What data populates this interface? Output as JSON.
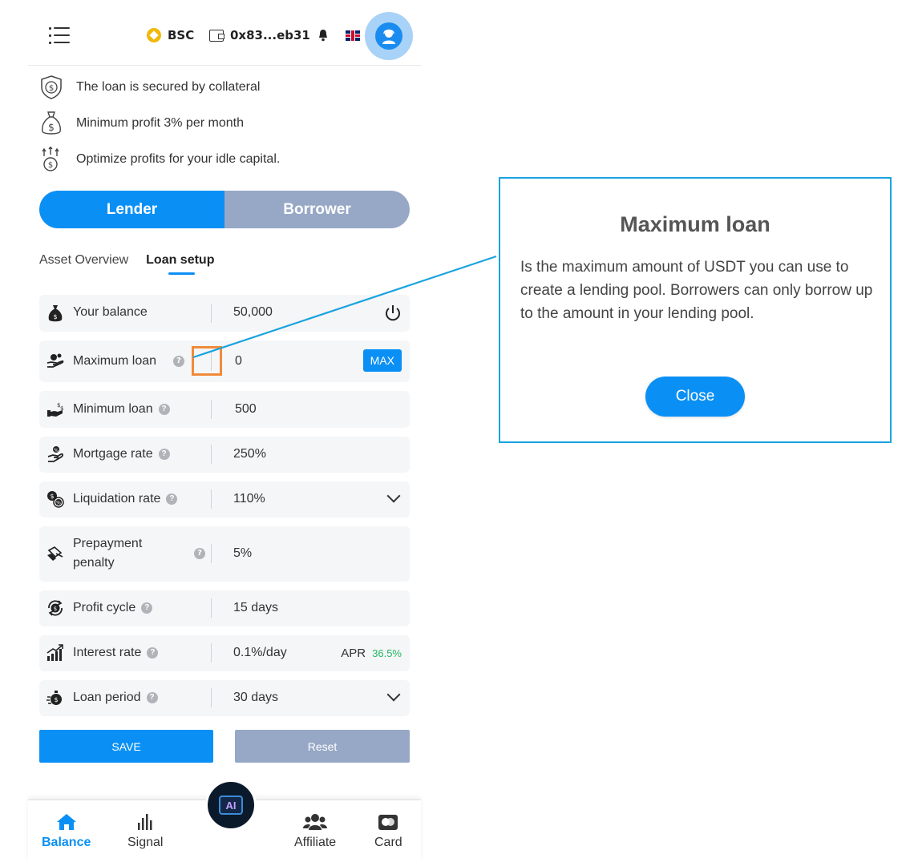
{
  "header": {
    "network": "BSC",
    "wallet_address": "0x83...eb31"
  },
  "features": [
    {
      "icon": "shield-dollar-icon",
      "text": "The loan is secured by collateral"
    },
    {
      "icon": "money-bag-icon",
      "text": "Minimum profit 3% per month"
    },
    {
      "icon": "coins-growth-icon",
      "text": "Optimize profits for your idle capital."
    }
  ],
  "mode_toggle": {
    "lender": "Lender",
    "borrower": "Borrower",
    "selected": "Lender"
  },
  "subtabs": {
    "asset_overview": "Asset Overview",
    "loan_setup": "Loan setup",
    "selected": "Loan setup"
  },
  "form": {
    "your_balance": {
      "label": "Your balance",
      "value": "50,000"
    },
    "maximum_loan": {
      "label": "Maximum loan",
      "value": "0",
      "max_label": "MAX"
    },
    "minimum_loan": {
      "label": "Minimum loan",
      "value": "500"
    },
    "mortgage_rate": {
      "label": "Mortgage rate",
      "value": "250%"
    },
    "liquidation_rate": {
      "label": "Liquidation rate",
      "value": "110%"
    },
    "prepayment_penalty": {
      "label_line1": "Prepayment",
      "label_line2": "penalty",
      "value": "5%"
    },
    "profit_cycle": {
      "label": "Profit cycle",
      "value": "15 days"
    },
    "interest_rate": {
      "label": "Interest rate",
      "value": "0.1%/day",
      "apr_label": "APR",
      "apr_value": "36.5%"
    },
    "loan_period": {
      "label": "Loan period",
      "value": "30 days"
    },
    "help_glyph": "?"
  },
  "actions": {
    "save": "SAVE",
    "reset": "Reset"
  },
  "bottom_nav": {
    "balance": "Balance",
    "signal": "Signal",
    "ai": "AI",
    "affiliate": "Affiliate",
    "card": "Card",
    "active": "Balance"
  },
  "dialog": {
    "title": "Maximum loan",
    "body": "Is the maximum amount of USDT you can use to create a lending pool. Borrowers can only borrow up to the amount in your lending pool.",
    "close": "Close"
  },
  "colors": {
    "primary": "#0a90f5",
    "inactive": "#97a8c6",
    "apr_green": "#22b85f",
    "highlight": "#f08a3a",
    "callout": "#1aa3e0"
  }
}
